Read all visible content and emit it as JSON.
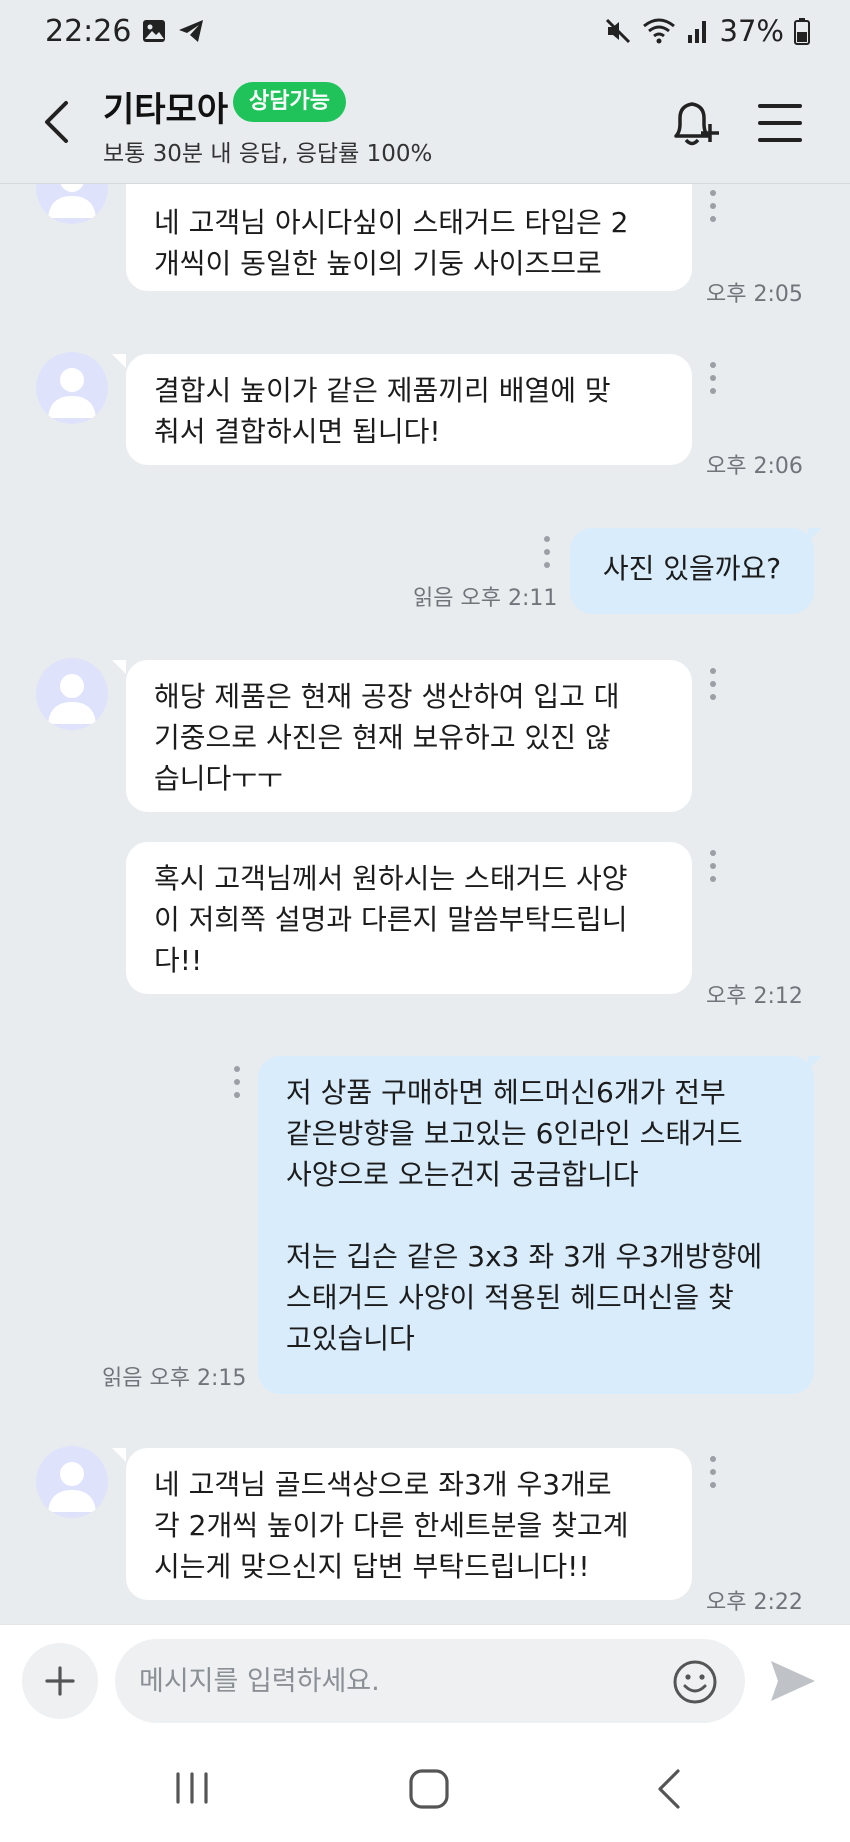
{
  "status_bar": {
    "time": "22:26",
    "battery": "37%",
    "icons": [
      "gallery-icon",
      "telegram-icon",
      "mute-icon",
      "wifi-icon",
      "signal-icon",
      "battery-icon"
    ]
  },
  "header": {
    "shop_name": "기타모아",
    "badge": "상담가능",
    "response_info": "보통 30분 내 응답, 응답률 100%",
    "accent_color": "#1fc35a"
  },
  "messages": [
    {
      "side": "in",
      "text": "네 고객님 아시다싶이 스태거드 타입은 2\n개씩이 동일한 높이의 기둥 사이즈므로",
      "time": "오후 2:05"
    },
    {
      "side": "in",
      "text": "결합시 높이가 같은 제품끼리 배열에 맞\n춰서 결합하시면 됩니다!",
      "time": "오후 2:06"
    },
    {
      "side": "out",
      "text": "사진 있을까요?",
      "time": "읽음 오후 2:11"
    },
    {
      "side": "in",
      "text": "해당 제품은 현재 공장 생산하여 입고 대\n기중으로 사진은 현재 보유하고 있진 않\n습니다ㅜㅜ",
      "time": ""
    },
    {
      "side": "in",
      "text": "혹시 고객님께서 원하시는 스태거드 사양\n이 저희쪽 설명과 다른지 말씀부탁드립니\n다!!",
      "time": "오후 2:12"
    },
    {
      "side": "out",
      "text": "저 상품 구매하면 헤드머신6개가 전부\n같은방향을 보고있는 6인라인 스태거드\n사양으로 오는건지 궁금합니다\n\n저는 깁슨 같은 3x3 좌 3개 우3개방향에\n스태거드 사양이 적용된 헤드머신을 찾\n고있습니다",
      "time": "읽음 오후 2:15"
    },
    {
      "side": "in",
      "text": "네 고객님 골드색상으로 좌3개 우3개로\n각 2개씩 높이가 다른 한세트분을 찾고계\n시는게 맞으신지 답변 부탁드립니다!!",
      "time": "오후 2:22"
    }
  ],
  "input": {
    "placeholder": "메시지를 입력하세요."
  },
  "colors": {
    "background": "#e9ecef",
    "incoming_bubble": "#ffffff",
    "outgoing_bubble": "#d9ecfb",
    "avatar": "#dfe2fb"
  }
}
